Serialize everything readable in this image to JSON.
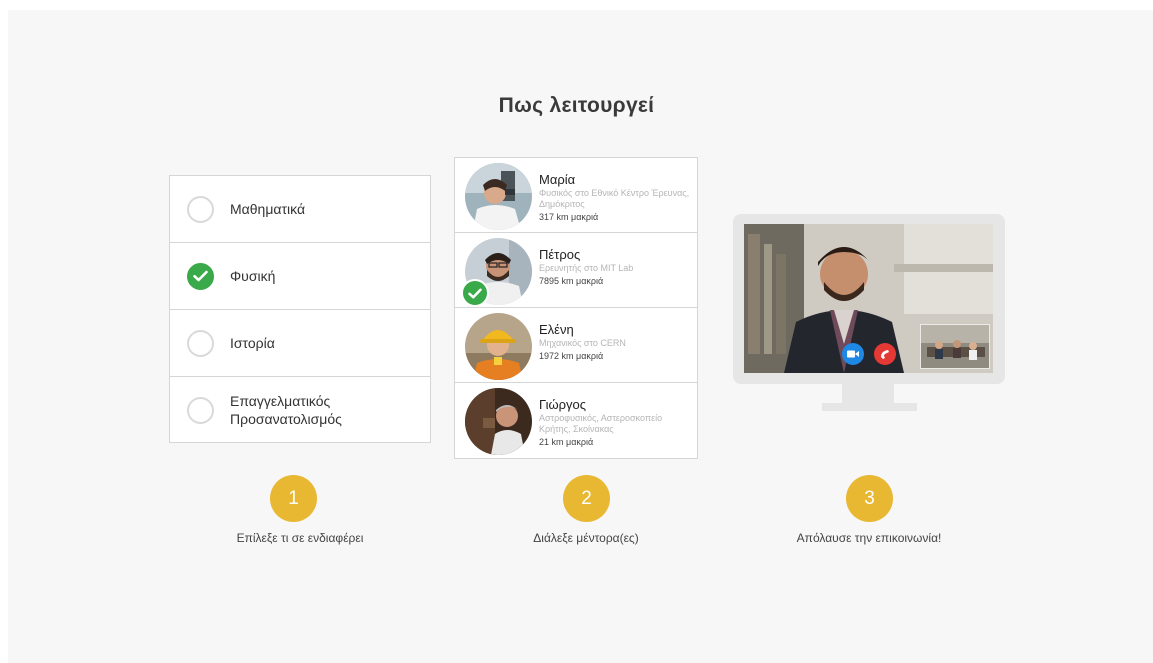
{
  "title": "Πως λειτουργεί",
  "subjects": [
    {
      "label": "Μαθηματικά",
      "checked": false
    },
    {
      "label": "Φυσική",
      "checked": true
    },
    {
      "label": "Ιστορία",
      "checked": false
    },
    {
      "label": "Επαγγελματικός Προσανατολισμός",
      "checked": false
    }
  ],
  "mentors": [
    {
      "name": "Μαρία",
      "role": "Φυσικός στο Εθνικό Κέντρο Έρευνας, Δημόκριτος",
      "distance": "317 km μακριά",
      "selected": false
    },
    {
      "name": "Πέτρος",
      "role": "Ερευνητής στο MIT Lab",
      "distance": "7895 km μακριά",
      "selected": true
    },
    {
      "name": "Ελένη",
      "role": "Μηχανικός στο CERN",
      "distance": "1972 km μακριά",
      "selected": false
    },
    {
      "name": "Γιώργος",
      "role": "Αστροφυσικός, Αστεροσκοπείο Κρήτης, Σκοίνακας",
      "distance": "21 km μακριά",
      "selected": false
    }
  ],
  "steps": [
    {
      "number": "1",
      "label": "Επίλεξε τι σε ενδιαφέρει"
    },
    {
      "number": "2",
      "label": "Διάλεξε μέντορα(ες)"
    },
    {
      "number": "3",
      "label": "Απόλαυσε την επικοινωνία!"
    }
  ],
  "icons": {
    "check": "check-icon",
    "video": "video-camera-icon",
    "hangup": "phone-hangup-icon"
  },
  "colors": {
    "accent": "#e8b832",
    "check_green": "#3aa949",
    "video_blue": "#1e88e5",
    "hangup_red": "#e53935"
  }
}
